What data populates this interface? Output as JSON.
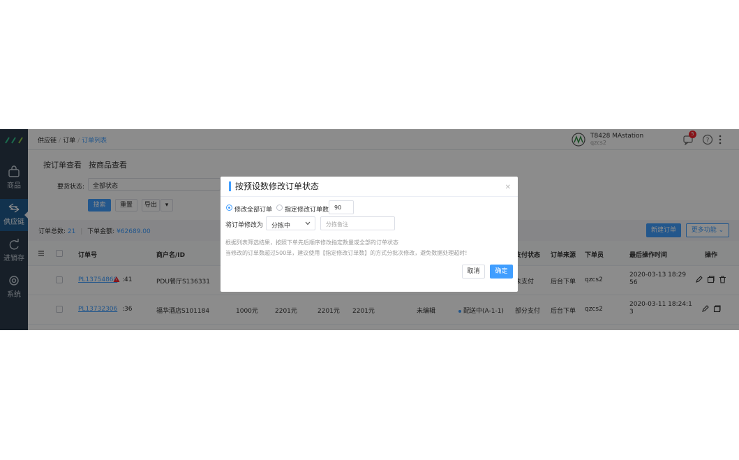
{
  "breadcrumb": [
    "供应链",
    "订单",
    "订单列表"
  ],
  "header": {
    "station_name": "T8428 MAstation",
    "station_user": "qzcs2",
    "notification_count": "5"
  },
  "sidebar": {
    "items": [
      {
        "label": "商品",
        "icon": "bag-icon"
      },
      {
        "label": "供应链",
        "icon": "exchange-icon"
      },
      {
        "label": "进销存",
        "icon": "refresh-icon"
      },
      {
        "label": "系统",
        "icon": "gear-icon"
      }
    ]
  },
  "tabs": [
    "按订单查看",
    "按商品查看"
  ],
  "filter": {
    "label": "要货状态:",
    "value": "全部状态"
  },
  "buttons": {
    "search": "搜索",
    "reset": "重置",
    "export": "导出",
    "new_order": "新建订单",
    "more": "更多功能"
  },
  "summary": {
    "total_label": "订单总数:",
    "total": "21",
    "amount_label": "下单金额:",
    "amount": "¥62689.00"
  },
  "table": {
    "headers": [
      "订单号",
      "商户名/ID",
      "支付状态",
      "订单来源",
      "下单员",
      "最后操作时间",
      "操作"
    ],
    "rows": [
      {
        "order_no": "PL13754860",
        "time_tail": ":41",
        "merchant": "PDU餐厅S136331",
        "pay": "未支付",
        "source": "后台下单",
        "operator": "qzcs2",
        "time1": "2020-03-13 18:29",
        "time2": "56"
      },
      {
        "order_no": "PL13732306",
        "time_tail": ":36",
        "merchant": "福华酒店S101184",
        "amt1": "1000元",
        "amt2": "2201元",
        "amt3": "2201元",
        "amt4": "2201元",
        "edit_state": "未编辑",
        "dist": "配送中(A-1-1)",
        "pay": "部分支付",
        "source": "后台下单",
        "operator": "qzcs2",
        "time1": "2020-03-11 18:24:1",
        "time2": "3"
      }
    ]
  },
  "modal": {
    "title": "按预设数修改订单状态",
    "radio_all": "修改全部订单",
    "radio_count": "指定修改订单数",
    "count_value": "90",
    "change_label": "将订单修改为",
    "status_value": "分拣中",
    "remark_placeholder": "分拣备注",
    "note1": "根据列表筛选结果，按照下单先后顺序修改指定数量或全部的订单状态",
    "note2": "当修改的订单数超过500单，建议使用【指定修改订单数】的方式分批次修改，避免数据处理超时!",
    "cancel": "取消",
    "confirm": "确定"
  }
}
